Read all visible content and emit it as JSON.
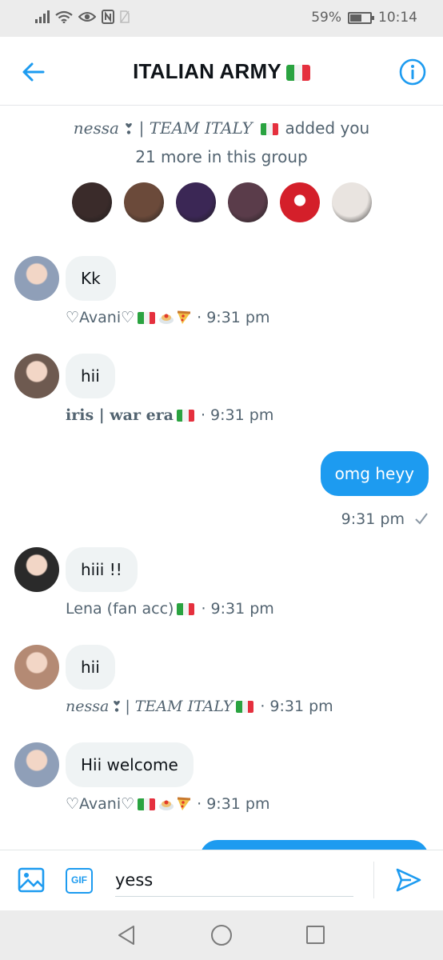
{
  "status_bar": {
    "battery": "59%",
    "battery_level": 0.59,
    "time": "10:14"
  },
  "header": {
    "title": "ITALIAN ARMY",
    "back_icon": "arrow-left-icon",
    "info_icon": "info-icon"
  },
  "group_info": {
    "adder_name": "nessa",
    "adder_team": "| TEAM ITALY",
    "added_text": "added you",
    "more_text": "21 more in this group",
    "member_avatars": [
      "#3a2b2a",
      "#6b4a3a",
      "#3b2755",
      "#5a3c4a",
      "#d41f2a",
      "#e9e4e0"
    ]
  },
  "messages": [
    {
      "sender": "♡Avani♡",
      "text": "Kk",
      "time": "9:31 pm",
      "avatar_color": "#8f9fb8"
    },
    {
      "sender": "iris | war era",
      "text": "hii",
      "time": "9:31 pm",
      "avatar_color": "#6e5a50"
    },
    {
      "sender": "Lena (fan acc)",
      "text": "hiii !!",
      "time": "9:31 pm",
      "avatar_color": "#2a2a2a"
    },
    {
      "sender_name": "nessa",
      "sender_team": "| TEAM ITALY",
      "text": "hii",
      "time": "9:31 pm",
      "avatar_color": "#b48a74"
    },
    {
      "sender": "♡Avani♡",
      "text": "Hii welcome",
      "time": "9:31 pm",
      "avatar_color": "#8f9fb8"
    }
  ],
  "outgoing": {
    "text": "omg heyy",
    "time": "9:31 pm",
    "status_icon": "checkmark-icon"
  },
  "composer": {
    "value": "yess",
    "image_icon": "image-icon",
    "gif_label": "GIF",
    "send_icon": "send-icon"
  },
  "navbar": {
    "back": "triangle-back-icon",
    "home": "circle-home-icon",
    "recent": "square-recent-icon"
  },
  "colors": {
    "accent": "#1d9bf0",
    "bubble_in": "#eff3f4",
    "meta": "#536471"
  }
}
